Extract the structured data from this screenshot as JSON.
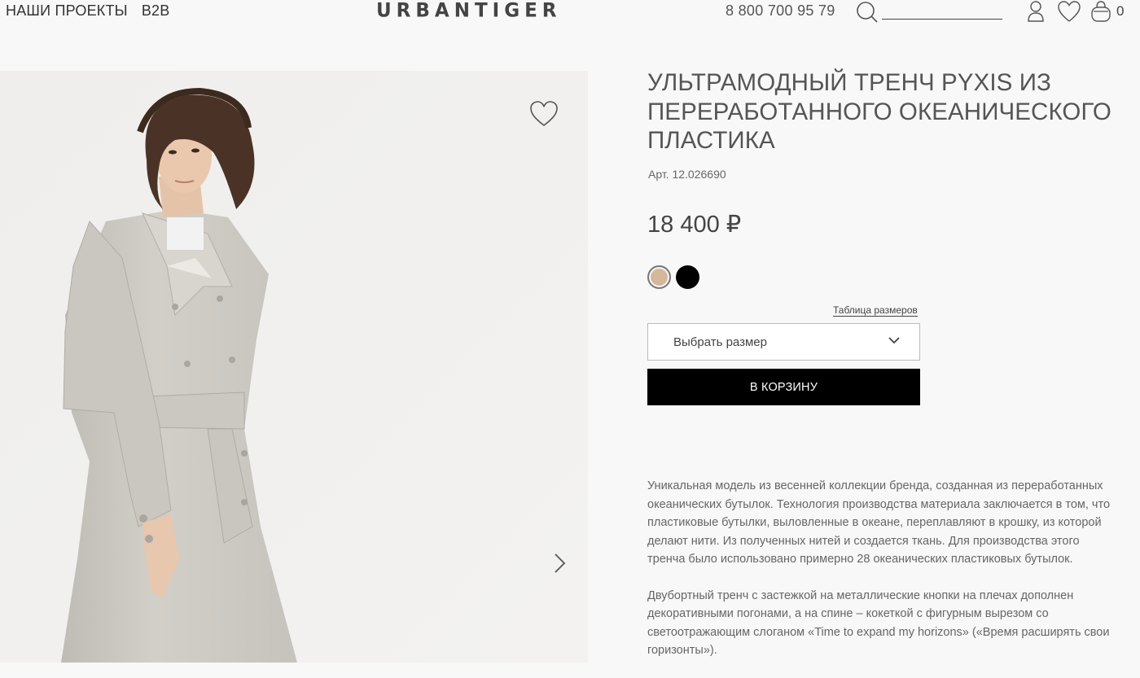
{
  "header": {
    "nav": [
      {
        "label": "НАШИ ПРОЕКТЫ"
      },
      {
        "label": "B2B"
      }
    ],
    "logo": "URBANTIGER",
    "phone": "8 800 700 95 79",
    "search": {
      "placeholder": "",
      "value": ""
    },
    "cart_count": "0",
    "icons": [
      "search-icon",
      "user-icon",
      "heart-icon",
      "bag-icon"
    ]
  },
  "product": {
    "title": "УЛЬТРАМОДНЫЙ ТРЕНЧ PYXIS ИЗ ПЕРЕРАБОТАННОГО ОКЕАНИЧЕСКОГО ПЛАСТИКА",
    "sku": "Арт. 12.026690",
    "price": "18 400 ₽",
    "colors": [
      {
        "name": "beige",
        "hex": "#d5b79c",
        "selected": true
      },
      {
        "name": "black",
        "hex": "#000000",
        "selected": false
      }
    ],
    "size_table_link": "Таблица размеров",
    "size_select_label": "Выбрать размер",
    "add_to_cart_label": "В КОРЗИНУ",
    "description": [
      "Уникальная модель из весенней коллекции бренда, созданная из переработанных океанических бутылок. Технология производства материала заключается в том, что пластиковые бутылки, выловленные в океане, переплавляют в крошку, из которой делают нити. Из полученных нитей и создается ткань. Для производства этого тренча было использовано примерно 28 океанических пластиковых бутылок.",
      "Двубортный тренч с застежкой на металлические кнопки на плечах дополнен декоративными погонами, а на спине – кокеткой с фигурным вырезом со светоотражающим слоганом «Time to expand my horizons» («Время расширять свои горизонты»)."
    ]
  },
  "colors": {
    "background": "#f8f8f8",
    "image_background": "#f0efed",
    "button": "#000000",
    "coat": "#cfccc6"
  }
}
